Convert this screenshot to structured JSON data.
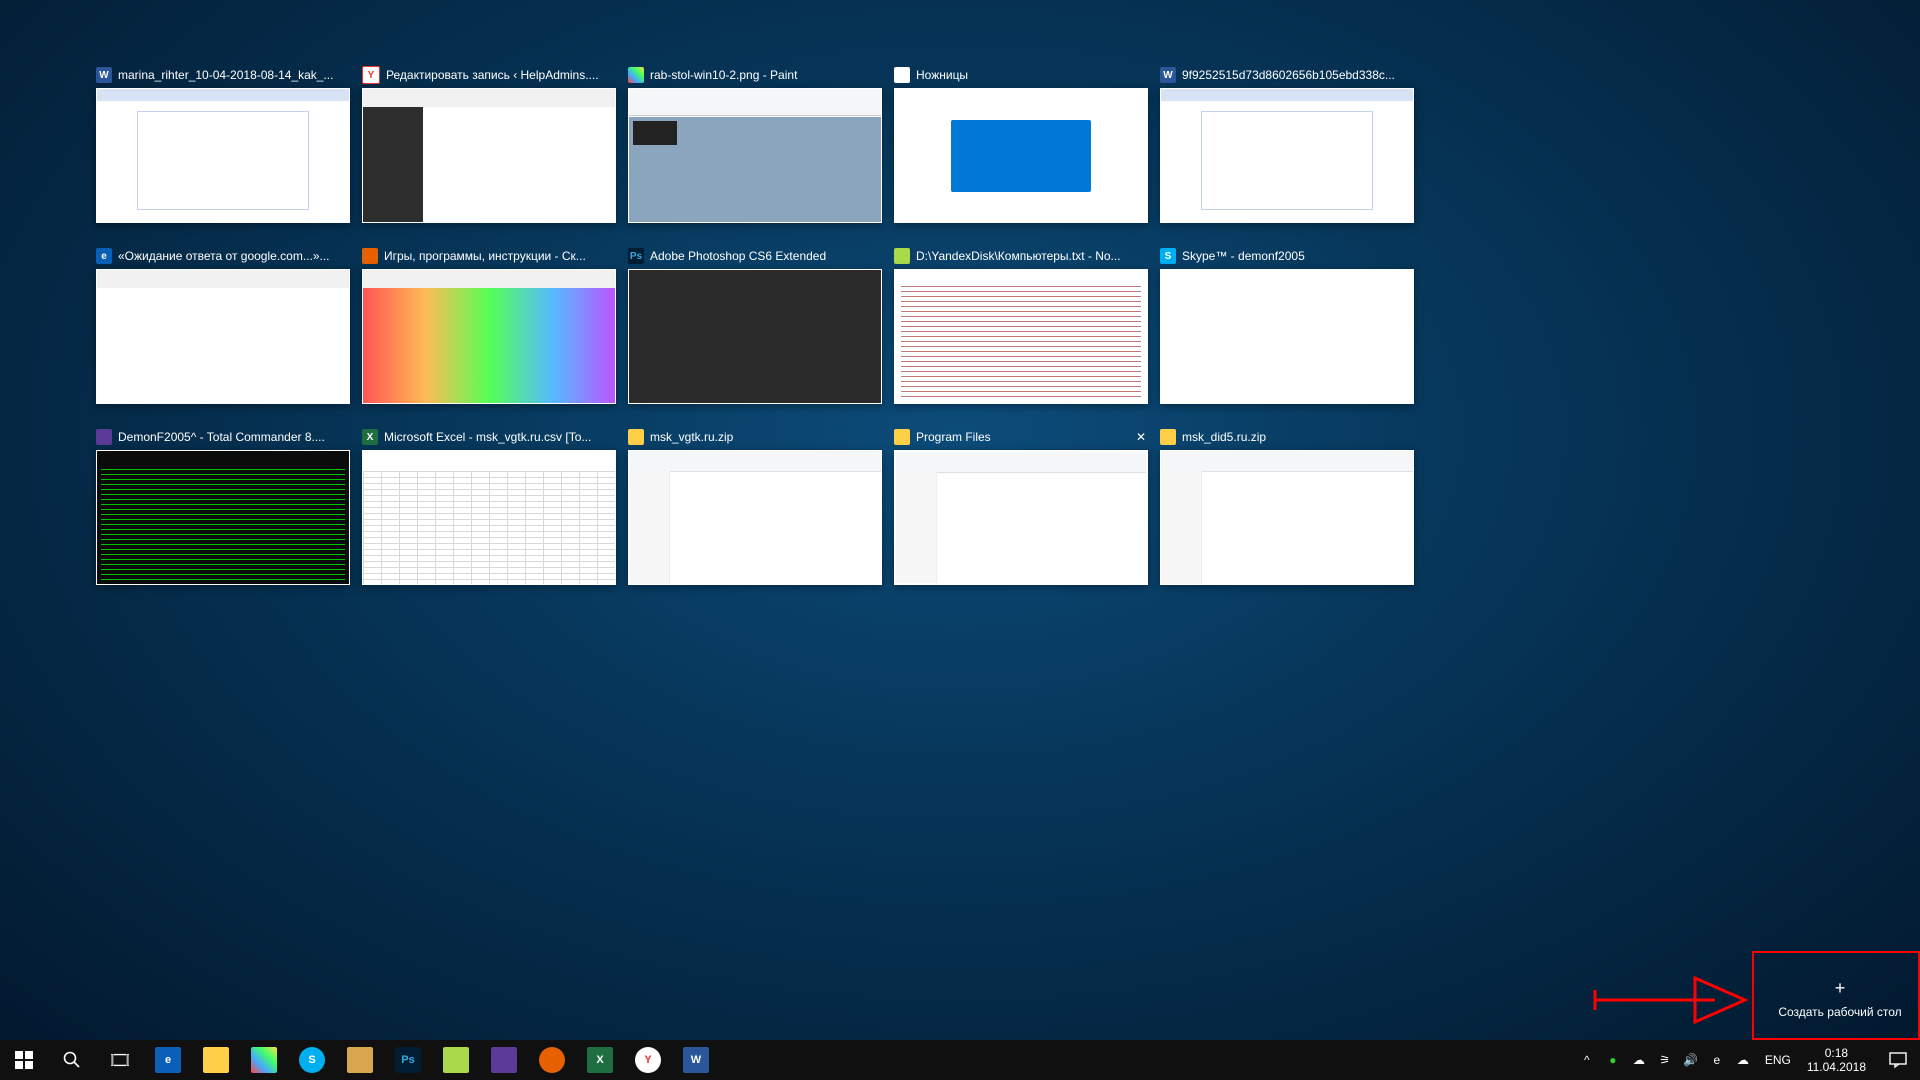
{
  "windows": [
    {
      "icon": "word",
      "title": "marina_rihter_10-04-2018-08-14_kak_...",
      "thumb": "word",
      "selected": false
    },
    {
      "icon": "yandex",
      "title": "Редактировать запись ‹ HelpAdmins....",
      "thumb": "browser",
      "selected": false
    },
    {
      "icon": "paint",
      "title": "rab-stol-win10-2.png - Paint",
      "thumb": "paint",
      "selected": false
    },
    {
      "icon": "scissors",
      "title": "Ножницы",
      "thumb": "scissors",
      "selected": false
    },
    {
      "icon": "word",
      "title": "9f9252515d73d8602656b105ebd338c...",
      "thumb": "word",
      "selected": false
    },
    {
      "icon": "edge",
      "title": "«Ожидание ответа от google.com...»...",
      "thumb": "edge",
      "selected": false
    },
    {
      "icon": "firefox",
      "title": "Игры, программы, инструкции - Ск...",
      "thumb": "firefox",
      "selected": false
    },
    {
      "icon": "photoshop",
      "title": "Adobe Photoshop CS6 Extended",
      "thumb": "photoshop",
      "selected": false
    },
    {
      "icon": "notepadpp",
      "title": "D:\\YandexDisk\\Компьютеры.txt - No...",
      "thumb": "text",
      "selected": false
    },
    {
      "icon": "skype",
      "title": "Skype™ - demonf2005",
      "thumb": "skype",
      "selected": false
    },
    {
      "icon": "totalcmd",
      "title": "DemonF2005^ - Total Commander 8....",
      "thumb": "tc",
      "selected": false
    },
    {
      "icon": "excel",
      "title": "Microsoft Excel - msk_vgtk.ru.csv  [To...",
      "thumb": "excel",
      "selected": false
    },
    {
      "icon": "folder",
      "title": "msk_vgtk.ru.zip",
      "thumb": "explorer",
      "selected": false
    },
    {
      "icon": "folder",
      "title": "Program Files",
      "thumb": "explorer",
      "selected": true,
      "close": "✕"
    },
    {
      "icon": "folder",
      "title": "msk_did5.ru.zip",
      "thumb": "explorer",
      "selected": false
    }
  ],
  "new_desktop_label": "Создать рабочий стол",
  "taskbar": {
    "apps": [
      {
        "name": "edge",
        "bg": "#0a5fb7",
        "txt": "e"
      },
      {
        "name": "file-explorer",
        "bg": "#ffcf48",
        "txt": ""
      },
      {
        "name": "paint",
        "bg": "linear-gradient(45deg,#f44,#4af,#4f6,#fd4)",
        "txt": ""
      },
      {
        "name": "skype",
        "bg": "#00aff0",
        "txt": "S",
        "round": true
      },
      {
        "name": "paint2",
        "bg": "#d9a84e",
        "txt": ""
      },
      {
        "name": "photoshop",
        "bg": "#001d34",
        "txt": "Ps",
        "fg": "#3ad"
      },
      {
        "name": "notepadpp",
        "bg": "#aad94c",
        "txt": ""
      },
      {
        "name": "totalcmd",
        "bg": "#5a3a96",
        "txt": ""
      },
      {
        "name": "firefox",
        "bg": "#e66000",
        "txt": "",
        "round": true
      },
      {
        "name": "excel",
        "bg": "#1d6f42",
        "txt": "X"
      },
      {
        "name": "yandex",
        "bg": "#ffffff",
        "txt": "Y",
        "fg": "#e33",
        "round": true
      },
      {
        "name": "word",
        "bg": "#2b579a",
        "txt": "W"
      }
    ],
    "lang": "ENG",
    "time": "0:18",
    "date": "11.04.2018"
  },
  "tray_icons": [
    "chevron-up",
    "green-dot",
    "cloud",
    "wifi",
    "volume",
    "app-e",
    "app-cloud"
  ]
}
